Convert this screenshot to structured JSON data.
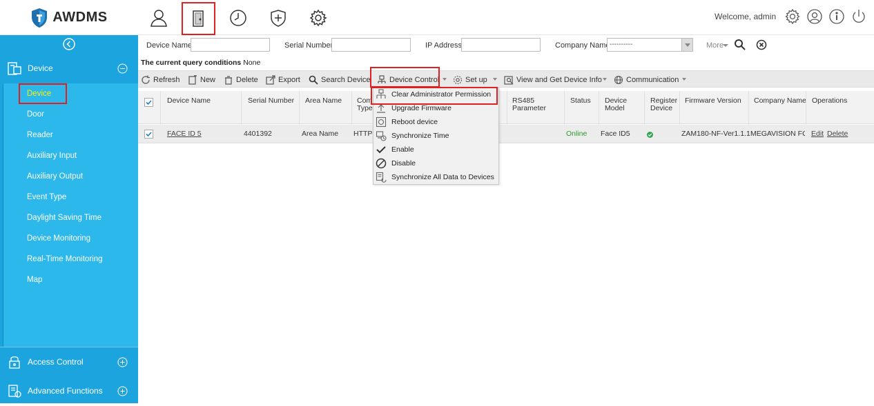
{
  "app": {
    "name": "AWDMS",
    "brand_color": "#1ca4df",
    "accent_color": "#ffee00",
    "highlight_color": "#e02020"
  },
  "topnav": {
    "icons": [
      "personnel-icon",
      "device-door-icon",
      "attendance-clock-icon",
      "access-shield-icon",
      "system-settings-icon"
    ],
    "welcome": "Welcome, admin"
  },
  "sidebar": {
    "device": {
      "label": "Device"
    },
    "items": [
      {
        "label": "Device",
        "active": true
      },
      {
        "label": "Door"
      },
      {
        "label": "Reader"
      },
      {
        "label": "Auxiliary Input"
      },
      {
        "label": "Auxiliary Output"
      },
      {
        "label": "Event Type"
      },
      {
        "label": "Daylight Saving Time"
      },
      {
        "label": "Device Monitoring"
      },
      {
        "label": "Real-Time Monitoring"
      },
      {
        "label": "Map"
      }
    ],
    "access_control": {
      "label": "Access Control"
    },
    "advanced_functions": {
      "label": "Advanced Functions"
    }
  },
  "filters": {
    "device_name": {
      "label": "Device Name",
      "value": ""
    },
    "serial_number": {
      "label": "Serial Number",
      "value": ""
    },
    "ip_address": {
      "label": "IP Address",
      "value": ""
    },
    "company_name": {
      "label": "Company Name",
      "value": "----------"
    },
    "more": "More"
  },
  "query": {
    "label": "The current query conditions",
    "value": "None"
  },
  "toolbar": {
    "refresh": "Refresh",
    "new": "New",
    "delete": "Delete",
    "export": "Export",
    "search_device": "Search Device",
    "device_control": "Device Control",
    "set_up": "Set up",
    "view_info": "View and Get Device Info",
    "communication": "Communication"
  },
  "table": {
    "headers": {
      "device_name": "Device Name",
      "serial_number": "Serial Number",
      "area_name": "Area Name",
      "comm_type_1": "Com",
      "comm_type_2": "Type",
      "rs485_1": "RS485",
      "rs485_2": "Parameter",
      "status": "Status",
      "device_model_1": "Device",
      "device_model_2": "Model",
      "register_1": "Register",
      "register_2": "Device",
      "firmware": "Firmware Version",
      "company": "Company Name",
      "operations": "Operations"
    },
    "rows": [
      {
        "checked": true,
        "device_name": "FACE ID 5",
        "serial_number": "4401392",
        "area_name": "Area Name",
        "comm_type": "HTTP",
        "status": "Online",
        "device_model": "Face ID5",
        "registered": true,
        "firmware": "ZAM180-NF-Ver1.1.1",
        "company": "MEGAVISION FO",
        "edit": "Edit",
        "delete": "Delete"
      }
    ]
  },
  "device_control_menu": {
    "items": [
      {
        "label": "Clear Administrator Permission",
        "icon": "clear-permission-icon",
        "highlighted": true
      },
      {
        "label": "Upgrade Firmware",
        "icon": "upgrade-firmware-icon"
      },
      {
        "label": "Reboot device",
        "icon": "reboot-icon"
      },
      {
        "label": "Synchronize Time",
        "icon": "sync-time-icon"
      },
      {
        "label": "Enable",
        "icon": "check-icon"
      },
      {
        "label": "Disable",
        "icon": "disable-icon"
      },
      {
        "label": "Synchronize All Data to Devices",
        "icon": "sync-data-icon"
      }
    ]
  }
}
